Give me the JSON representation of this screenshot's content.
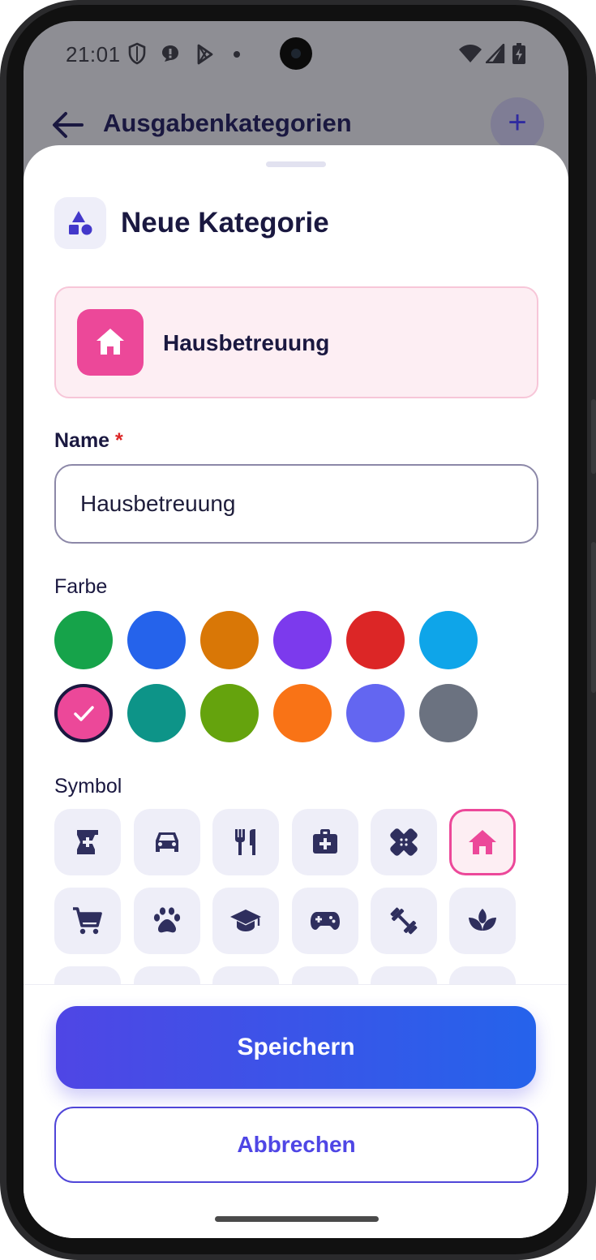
{
  "status_bar": {
    "time": "21:01",
    "icons": [
      "shield-icon",
      "notification-bubble-icon",
      "play-store-icon",
      "dot-icon",
      "wifi-icon",
      "signal-icon",
      "battery-charging-icon"
    ]
  },
  "app_bar": {
    "title": "Ausgabenkategorien",
    "back_icon": "arrow-back-icon",
    "add_label": "+"
  },
  "sheet": {
    "title": "Neue Kategorie",
    "header_icon": "category-shapes-icon",
    "preview": {
      "name": "Hausbetreuung",
      "icon": "home-icon",
      "color": "#ec4899"
    },
    "name_field": {
      "label": "Name",
      "required_mark": "*",
      "value": "Hausbetreuung"
    },
    "color_section": {
      "label": "Farbe",
      "colors": [
        "#16a34a",
        "#2563eb",
        "#d97706",
        "#7c3aed",
        "#dc2626",
        "#0ea5e9",
        "#ec4899",
        "#0d9488",
        "#65a30d",
        "#f97316",
        "#6366f1",
        "#6b7280"
      ],
      "selected_index": 6
    },
    "symbol_section": {
      "label": "Symbol",
      "symbols": [
        "pharmacy-icon",
        "car-icon",
        "restaurant-icon",
        "medical-bag-icon",
        "bandage-icon",
        "home-icon",
        "shopping-cart-icon",
        "paw-icon",
        "graduation-cap-icon",
        "gamepad-icon",
        "dumbbell-icon",
        "spa-icon"
      ],
      "selected_index": 5
    }
  },
  "footer": {
    "save_label": "Speichern",
    "cancel_label": "Abbrechen"
  },
  "colors": {
    "accent": "#4f46e5",
    "title_text": "#1a1840",
    "icon_color": "#2f2f5e",
    "selected_pink": "#ec4899"
  }
}
